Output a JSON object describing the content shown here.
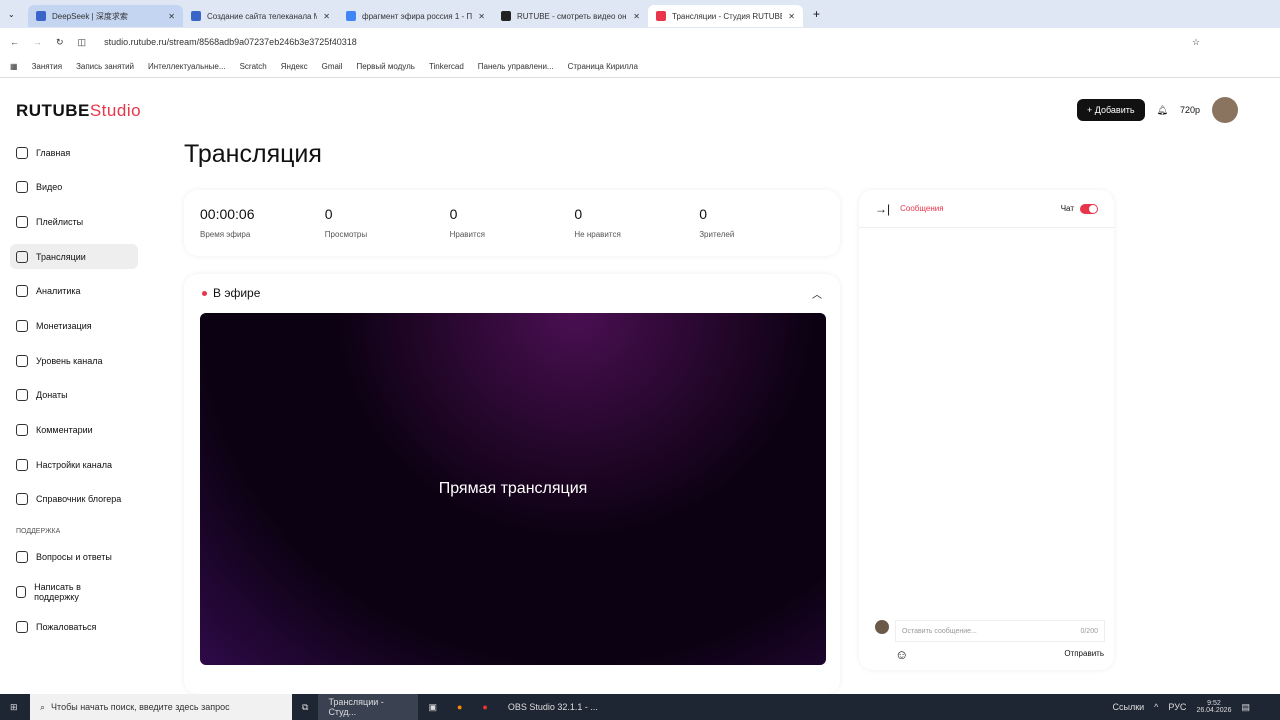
{
  "browser": {
    "tabs": [
      "DeepSeek | 深度求索",
      "Создание сайта телеканала М",
      "фрагмент эфира россия 1 - П",
      "RUTUBE - смотреть видео он",
      "Трансляции - Студия RUTUBE"
    ],
    "url": "studio.rutube.ru/stream/8568adb9a07237eb246b3e3725f40318",
    "bookmarks": [
      "Занятия",
      "Запись занятий",
      "Интеллектуальные...",
      "Scratch",
      "Яндекс",
      "Gmail",
      "Первый модуль",
      "Tinkercad",
      "Панель управлени...",
      "Страница Кирилла"
    ]
  },
  "header": {
    "logo": "RUTUBE",
    "logo_suffix": "Studio",
    "add": "Добавить",
    "quality": "720p"
  },
  "sidebar": {
    "items": [
      "Главная",
      "Видео",
      "Плейлисты",
      "Трансляции",
      "Аналитика",
      "Монетизация",
      "Уровень канала",
      "Донаты",
      "Комментарии",
      "Настройки канала",
      "Справочник блогера"
    ],
    "support_label": "ПОДДЕРЖКА",
    "support": [
      "Вопросы и ответы",
      "Написать в поддержку",
      "Пожаловаться"
    ]
  },
  "page": {
    "title": "Трансляция",
    "stats": [
      {
        "value": "00:00:06",
        "label": "Время эфира"
      },
      {
        "value": "0",
        "label": "Просмотры"
      },
      {
        "value": "0",
        "label": "Нравится"
      },
      {
        "value": "0",
        "label": "Не нравится"
      },
      {
        "value": "0",
        "label": "Зрителей"
      }
    ],
    "live_label": "В эфире",
    "video_text": "Прямая трансляция"
  },
  "chat": {
    "tab": "Сообщения",
    "toggle_label": "Чат",
    "placeholder": "Оставить сообщение...",
    "counter": "0/200",
    "send": "Отправить"
  },
  "taskbar": {
    "search": "Чтобы начать поиск, введите здесь запрос",
    "apps": [
      "Трансляции - Студ...",
      "OBS Studio 32.1.1 - ..."
    ],
    "links": "Ссылки",
    "lang": "РУС",
    "time": "9:52",
    "date": "26.04.2026"
  }
}
